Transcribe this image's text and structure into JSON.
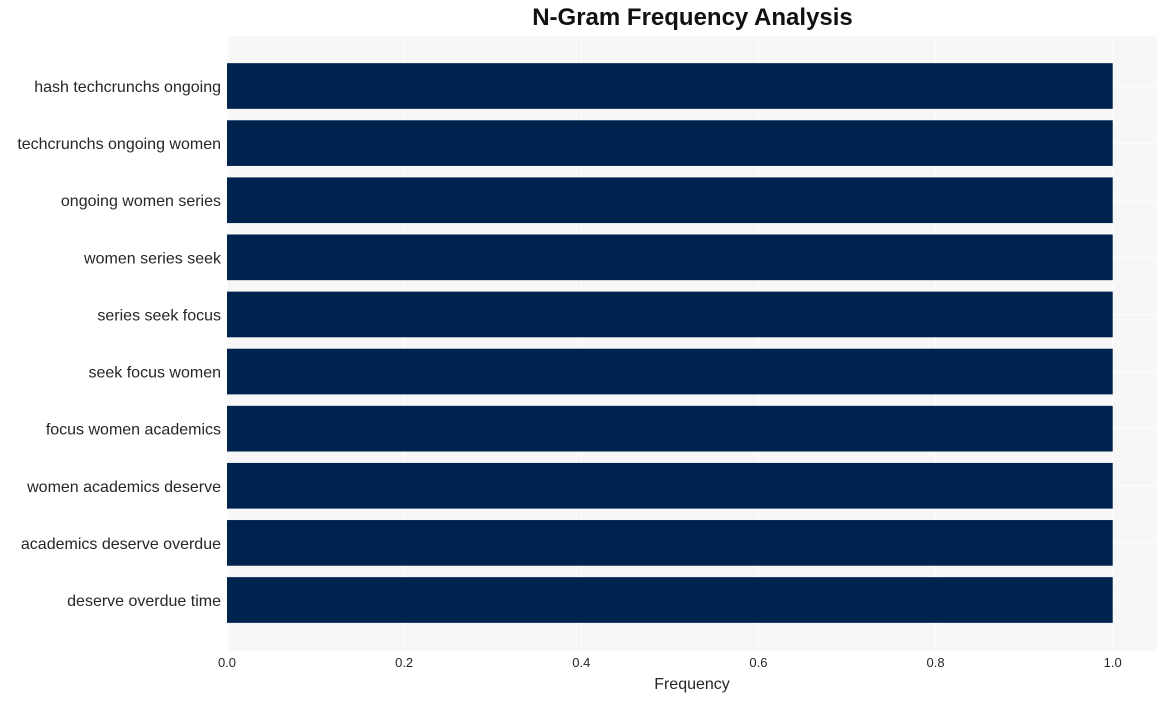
{
  "chart_data": {
    "type": "bar",
    "orientation": "horizontal",
    "title": "N-Gram Frequency Analysis",
    "xlabel": "Frequency",
    "ylabel": "",
    "categories": [
      "hash techcrunchs ongoing",
      "techcrunchs ongoing women",
      "ongoing women series",
      "women series seek",
      "series seek focus",
      "seek focus women",
      "focus women academics",
      "women academics deserve",
      "academics deserve overdue",
      "deserve overdue time"
    ],
    "values": [
      1,
      1,
      1,
      1,
      1,
      1,
      1,
      1,
      1,
      1
    ],
    "xlim": [
      0,
      1.05
    ],
    "xticks": [
      0.0,
      0.2,
      0.4,
      0.6,
      0.8,
      1.0
    ],
    "xtick_labels": [
      "0.0",
      "0.2",
      "0.4",
      "0.6",
      "0.8",
      "1.0"
    ],
    "grid": true,
    "legend": "none",
    "colors": {
      "bar": "#00224e",
      "plot_background": "#f7f7f7",
      "grid": "#ffffff",
      "text": "#262626"
    }
  }
}
